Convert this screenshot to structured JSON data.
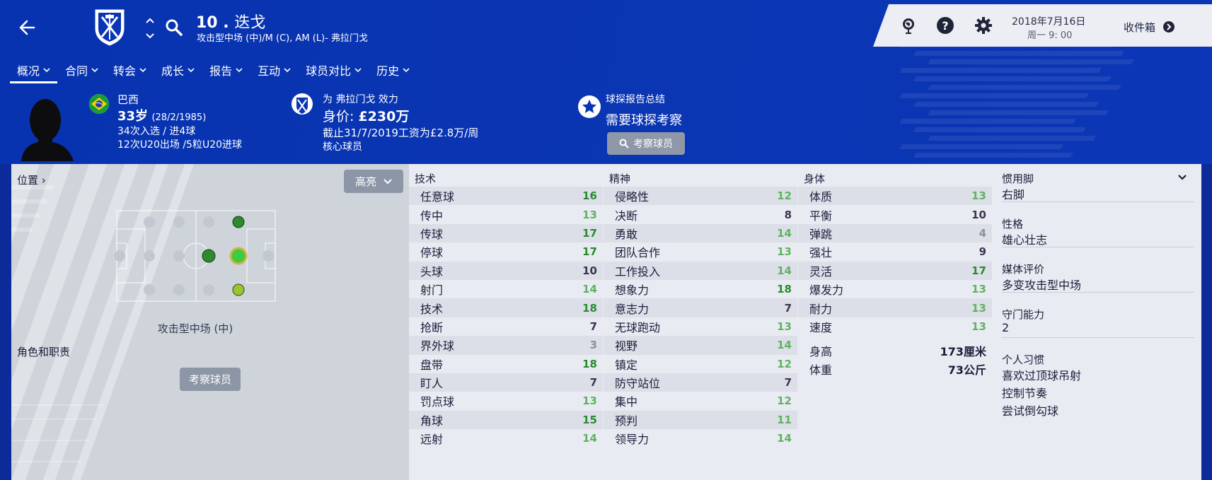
{
  "header": {
    "number": "10 .",
    "name": "迭戈",
    "positions": "攻击型中场 (中)/M (C), AM (L)- 弗拉门戈"
  },
  "top_right": {
    "date": "2018年7月16日",
    "time": "周一 9: 00",
    "inbox": "收件箱"
  },
  "nav": {
    "items": [
      "概况",
      "合同",
      "转会",
      "成长",
      "报告",
      "互动",
      "球员对比",
      "历史"
    ],
    "active": "概况"
  },
  "info": {
    "nation": "巴西",
    "age": "33岁",
    "birth": "(28/2/1985)",
    "caps": "34次入选 / 进4球",
    "u20": "12次U20出场 /5粒U20进球",
    "plays_for": "为 弗拉门戈 效力",
    "value_label": "身价: ",
    "value_amount": "£230万",
    "wage": "截止31/7/2019工资为£2.8万/周",
    "squad_role": "核心球员",
    "scout_summary_label": "球探报告总结",
    "scout_summary_value": "需要球探考察",
    "scout_button": "考察球员"
  },
  "position_panel": {
    "link": "位置 ›",
    "highlight_button": "高亮",
    "position_caption": "攻击型中场 (中)",
    "role_title": "角色和职责",
    "scout_button": "考察球员"
  },
  "attributes": {
    "technical": {
      "title": "技术",
      "rows": [
        {
          "name": "任意球",
          "value": "16"
        },
        {
          "name": "传中",
          "value": "13"
        },
        {
          "name": "传球",
          "value": "17"
        },
        {
          "name": "停球",
          "value": "17"
        },
        {
          "name": "头球",
          "value": "10"
        },
        {
          "name": "射门",
          "value": "14"
        },
        {
          "name": "技术",
          "value": "18"
        },
        {
          "name": "抢断",
          "value": "7"
        },
        {
          "name": "界外球",
          "value": "3"
        },
        {
          "name": "盘带",
          "value": "18"
        },
        {
          "name": "盯人",
          "value": "7"
        },
        {
          "name": "罚点球",
          "value": "13"
        },
        {
          "name": "角球",
          "value": "15"
        },
        {
          "name": "远射",
          "value": "14"
        }
      ]
    },
    "mental": {
      "title": "精神",
      "rows": [
        {
          "name": "侵略性",
          "value": "12"
        },
        {
          "name": "决断",
          "value": "8"
        },
        {
          "name": "勇敢",
          "value": "14"
        },
        {
          "name": "团队合作",
          "value": "13"
        },
        {
          "name": "工作投入",
          "value": "14"
        },
        {
          "name": "想象力",
          "value": "18"
        },
        {
          "name": "意志力",
          "value": "7"
        },
        {
          "name": "无球跑动",
          "value": "13"
        },
        {
          "name": "视野",
          "value": "14"
        },
        {
          "name": "镇定",
          "value": "12"
        },
        {
          "name": "防守站位",
          "value": "7"
        },
        {
          "name": "集中",
          "value": "12"
        },
        {
          "name": "预判",
          "value": "11"
        },
        {
          "name": "领导力",
          "value": "14"
        }
      ]
    },
    "physical": {
      "title": "身体",
      "rows": [
        {
          "name": "体质",
          "value": "13"
        },
        {
          "name": "平衡",
          "value": "10"
        },
        {
          "name": "弹跳",
          "value": "4"
        },
        {
          "name": "强壮",
          "value": "9"
        },
        {
          "name": "灵活",
          "value": "17"
        },
        {
          "name": "爆发力",
          "value": "13"
        },
        {
          "name": "耐力",
          "value": "13"
        },
        {
          "name": "速度",
          "value": "13"
        }
      ],
      "height_label": "身高",
      "height_value": "173厘米",
      "weight_label": "体重",
      "weight_value": "73公斤"
    }
  },
  "side": {
    "foot_label": "惯用脚",
    "foot_value": "右脚",
    "personality_label": "性格",
    "personality_value": "雄心壮志",
    "media_label": "媒体评价",
    "media_value": "多变攻击型中场",
    "gk_label": "守门能力",
    "gk_value": "2",
    "habits_label": "个人习惯",
    "habits": [
      "喜欢过顶球吊射",
      "控制节奏",
      "尝试倒勾球"
    ]
  },
  "colors": {
    "header_blue": "#0a35b3",
    "attr_high": "#2b8a2e",
    "attr_good": "#5fb35f",
    "attr_mid": "#3a3550",
    "attr_low": "#8a8fa0"
  }
}
